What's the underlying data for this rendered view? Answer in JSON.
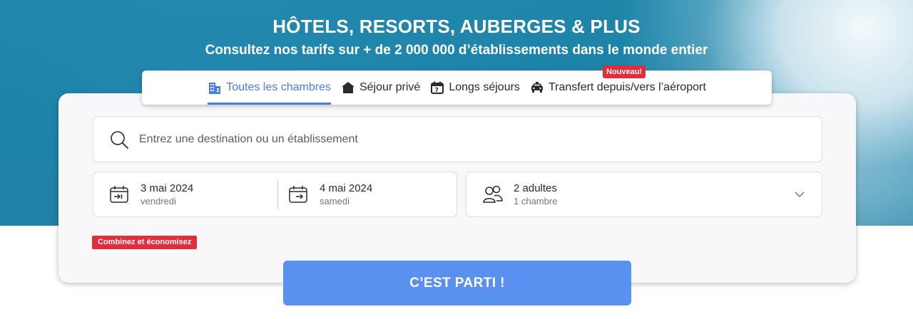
{
  "hero": {
    "title": "HÔTELS, RESORTS, AUBERGES & PLUS",
    "subtitle": "Consultez nos tarifs sur + de 2 000 000 d’établissements dans le monde entier"
  },
  "tabs": [
    {
      "label": "Toutes les chambres",
      "icon": "building-icon",
      "active": true
    },
    {
      "label": "Séjour privé",
      "icon": "house-icon",
      "active": false
    },
    {
      "label": "Longs séjours",
      "icon": "calendar-7-icon",
      "active": false
    },
    {
      "label": "Transfert depuis/vers l’aéroport",
      "icon": "taxi-icon",
      "active": false
    }
  ],
  "new_badge": "Nouveau!",
  "search": {
    "placeholder": "Entrez une destination ou un établissement",
    "value": ""
  },
  "checkin": {
    "date": "3 mai 2024",
    "day": "vendredi"
  },
  "checkout": {
    "date": "4 mai 2024",
    "day": "samedi"
  },
  "guests": {
    "main": "2 adultes",
    "sub": "1 chambre"
  },
  "combo_badge": "Combinez et économisez",
  "submit_label": "C’EST PARTI !",
  "colors": {
    "accent": "#4a7de8",
    "button": "#5a90ef",
    "badge": "#e12d3c"
  }
}
